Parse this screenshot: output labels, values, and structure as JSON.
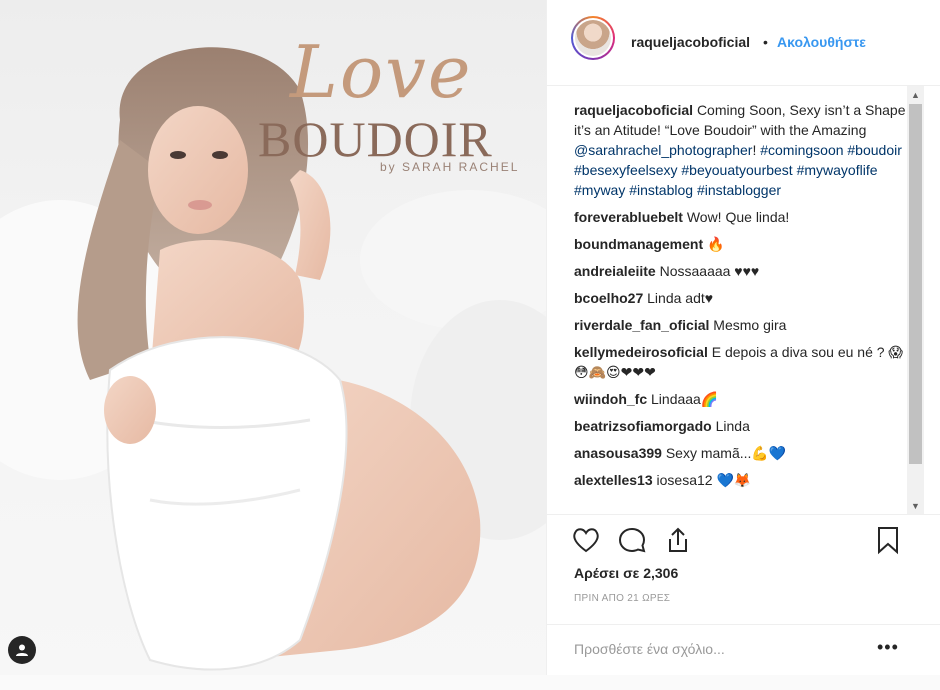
{
  "post": {
    "photo_overlay": {
      "title_love": "Love",
      "title_boudoir": "BOUDOIR",
      "byline": "by SARAH RACHEL"
    }
  },
  "header": {
    "username": "raqueljacoboficial",
    "separator": "•",
    "follow_label": "Ακολουθήστε"
  },
  "caption": {
    "username": "raqueljacoboficial",
    "text_1": "Coming Soon, Sexy isn’t a Shape it’s an Atitude! “Love Boudoir” with the Amazing",
    "mention": "@sarahrachel_photographer",
    "text_2": "!",
    "hashtags": "#comingsoon #boudoir #besexyfeelsexy #beyouatyourbest #mywayoflife #myway #instablog #instablogger"
  },
  "comments": [
    {
      "user": "foreverabluebelt",
      "text": "Wow! Que linda!"
    },
    {
      "user": "boundmanagement",
      "text": "🔥"
    },
    {
      "user": "andreialeiite",
      "text": "Nossaaaaa ♥♥♥"
    },
    {
      "user": "bcoelho27",
      "text": "Linda adt♥"
    },
    {
      "user": "riverdale_fan_oficial",
      "text": "Mesmo gira"
    },
    {
      "user": "kellymedeirosoficial",
      "text": "E depois a diva sou eu né ? 😱😳🙈😍❤❤❤"
    },
    {
      "user": "wiindoh_fc",
      "text": "Lindaaa🌈"
    },
    {
      "user": "beatrizsofiamorgado",
      "text": "Linda"
    },
    {
      "user": "anasousa399",
      "text": "Sexy mamã...💪💙"
    },
    {
      "user": "alextelles13",
      "text": "iosesa12 💙🦊"
    }
  ],
  "actions": {
    "like_icon": "heart-icon",
    "comment_icon": "comment-icon",
    "share_icon": "share-icon",
    "save_icon": "bookmark-icon"
  },
  "likes_text": "Αρέσει σε 2,306",
  "timestamp": "ΠΡΙΝ ΑΠΟ 21 ΩΡΕΣ",
  "add_comment": {
    "placeholder": "Προσθέστε ένα σχόλιο...",
    "more": "•••"
  },
  "scrollbar": {
    "up": "▲",
    "down": "▼"
  },
  "colors": {
    "link": "#003569",
    "follow": "#3897f0",
    "text": "#262626",
    "muted": "#999999"
  }
}
